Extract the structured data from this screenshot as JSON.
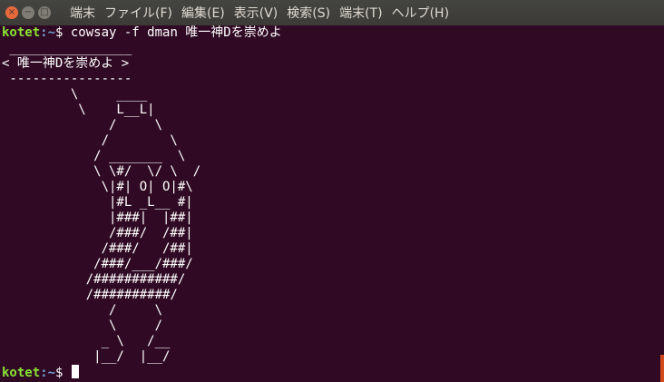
{
  "menubar": {
    "window_buttons": {
      "close": "×",
      "minimize": "−",
      "maximize": "□"
    },
    "items": [
      "端末",
      "ファイル(F)",
      "編集(E)",
      "表示(V)",
      "検索(S)",
      "端末(T)",
      "ヘルプ(H)"
    ]
  },
  "terminal": {
    "prompt_user": "kotet",
    "prompt_path": ":~",
    "prompt_symbol": "$ ",
    "command": "cowsay -f dman 唯一神Dを崇めよ",
    "output": [
      " ________________",
      "< 唯一神Dを崇めよ >",
      " ----------------",
      "         \\     ____",
      "          \\    L__L|",
      "              /     \\",
      "             /        \\",
      "            / _______  \\",
      "            \\ \\#/  \\/ \\  /",
      "             \\|#| O| O|#\\",
      "              |#L _L__ #|",
      "              |###|  |##|",
      "              /###/  /##|",
      "             /###/   /##|",
      "            /###/___/###/",
      "           /###########/",
      "           /##########/",
      "              /     \\",
      "              \\     /",
      "             _ \\   /__",
      "            |__/  |__/"
    ]
  },
  "colors": {
    "background": "#300a24",
    "prompt_user": "#8ae234",
    "prompt_path": "#729fcf",
    "text": "#ffffff",
    "menubar": "#3c3b37",
    "close_button": "#e8693b"
  }
}
